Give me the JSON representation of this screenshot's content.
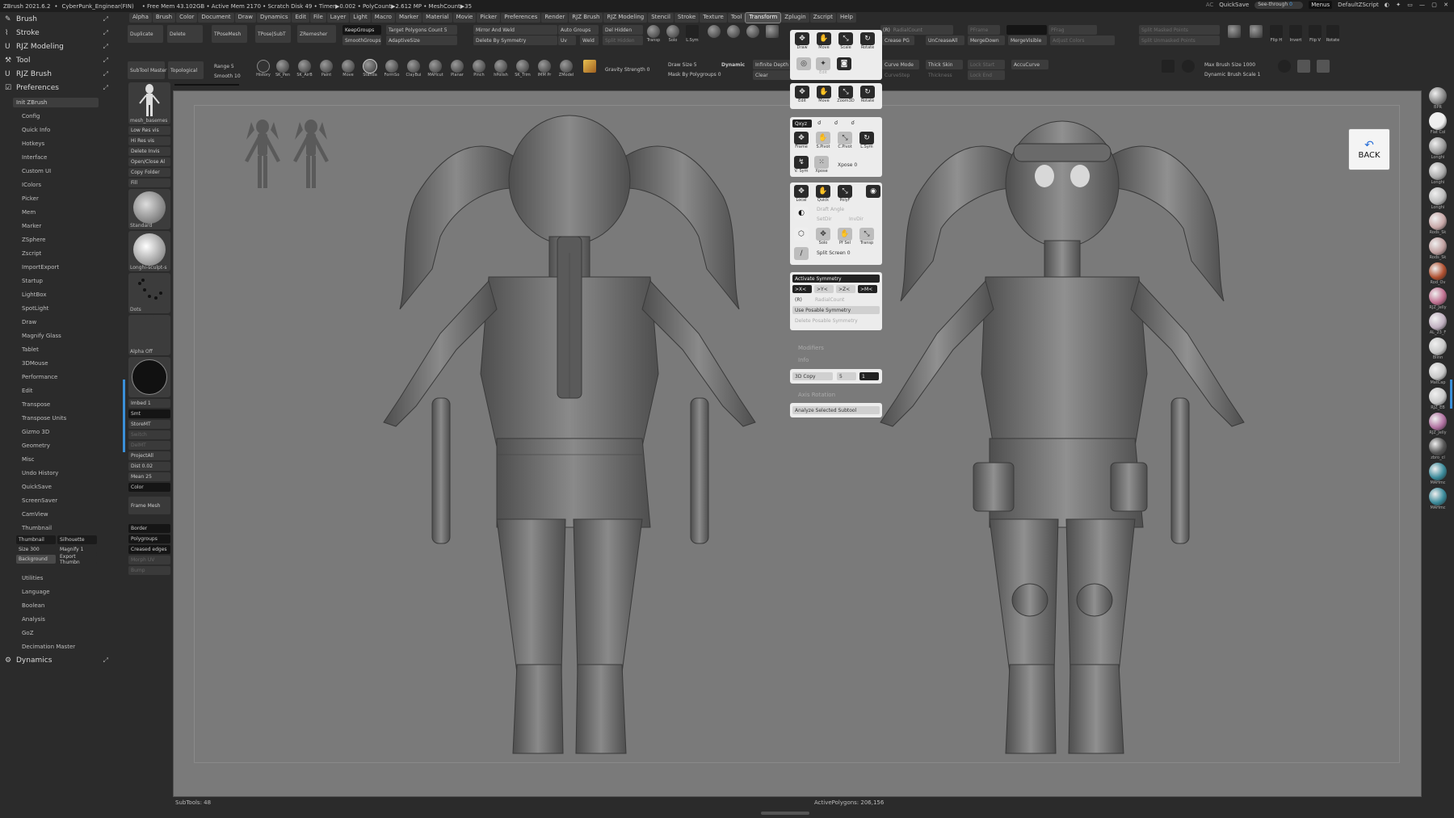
{
  "titlebar": {
    "app": "ZBrush 2021.6.2",
    "file": "CyberPunk_Enginear(FIN)",
    "stats": "• Free Mem 43.102GB • Active Mem 2170 • Scratch Disk 49 • Timer▶0.002 • PolyCount▶2.612 MP • MeshCount▶35",
    "ac": "AC",
    "quicksave": "QuickSave",
    "seethrough": "See-through",
    "seethrough_value": "0",
    "menus": "Menus",
    "zscript": "DefaultZScript"
  },
  "menubar": [
    "Alpha",
    "Brush",
    "Color",
    "Document",
    "Draw",
    "Dynamics",
    "Edit",
    "File",
    "Layer",
    "Light",
    "Macro",
    "Marker",
    "Material",
    "Movie",
    "Picker",
    "Preferences",
    "Render",
    "RJZ Brush",
    "RJZ Modeling",
    "Stencil",
    "Stroke",
    "Texture",
    "Tool",
    "Transform",
    "Zplugin",
    "Zscript",
    "Help"
  ],
  "menubar_active": "Transform",
  "leftpanel": {
    "headers": [
      {
        "icon": "brush-icon",
        "glyph": "✎",
        "label": "Brush"
      },
      {
        "icon": "stroke-icon",
        "glyph": "⌇",
        "label": "Stroke"
      },
      {
        "icon": "user-icon",
        "glyph": "U",
        "label": "RJZ Modeling"
      },
      {
        "icon": "tool-icon",
        "glyph": "⚒",
        "label": "Tool"
      },
      {
        "icon": "user-icon",
        "glyph": "U",
        "label": "RJZ Brush"
      },
      {
        "icon": "checkbox-icon",
        "glyph": "☑",
        "label": "Preferences"
      }
    ],
    "init_button": "Init ZBrush",
    "pref_items": [
      "Config",
      "Quick Info",
      "Hotkeys",
      "Interface",
      "Custom UI",
      "IColors",
      "Picker",
      "Mem",
      "Marker",
      "ZSphere",
      "Zscript",
      "ImportExport",
      "Startup",
      "LightBox",
      "SpotLight",
      "Draw",
      "Magnify Glass",
      "Tablet",
      "3DMouse",
      "Performance",
      "Edit",
      "Transpose",
      "Transpose Units",
      "Gizmo 3D",
      "Geometry",
      "Misc",
      "Undo History",
      "QuickSave",
      "ScreenSaver",
      "CamView",
      "Thumbnail"
    ],
    "thumb_row1": [
      "Thumbnail",
      "Silhouette"
    ],
    "thumb_row2": [
      "Size 300",
      "Magnify 1"
    ],
    "thumb_row3": [
      "Background",
      "Export Thumbn"
    ],
    "post_items": [
      "Utilities",
      "Language",
      "Boolean",
      "Analysis",
      "GoZ",
      "Decimation Master"
    ],
    "dynamics": {
      "glyph": "⚙",
      "label": "Dynamics"
    }
  },
  "toolcol": {
    "subtool_master": "SubTool Master",
    "topological": "Topological",
    "mesh_name": "mesh_basemes",
    "buttons_a": [
      "Low Res vis",
      "Hi Res vis",
      "Delete Invis",
      "Open/Close Al",
      "Copy Folder",
      "Fill"
    ],
    "thumbs": [
      "Standard",
      "Longhi-sculpt-s",
      "Dots",
      "Alpha Off"
    ],
    "buttons_b": [
      "Imbed 1",
      "Smt",
      "StoreMT",
      "Switch",
      "DelMT",
      "ProjectAll",
      "Dist 0.02",
      "Mean 25",
      "Color"
    ],
    "frame_mesh": "Frame Mesh",
    "buttons_c": [
      "Border",
      "Polygroups",
      "Creased edges",
      "Morph UV",
      "Bump"
    ]
  },
  "topbar1": {
    "duplicate": "Duplicate",
    "delete": "Delete",
    "tposemesh": "TPoseMesh",
    "tposesubt": "TPose|SubT",
    "zremesher": "ZRemesher",
    "keepgroups": "KeepGroups",
    "smoothgroups": "SmoothGroups",
    "target_poly": "Target Polygons Count 5",
    "adaptivesize": "AdaptiveSize",
    "mirror_weld": "Mirror And Weld",
    "delete_sym": "Delete By Symmetry",
    "auto_groups": "Auto Groups",
    "uv": "Uv",
    "weld": "Weld",
    "del_hidden": "Del Hidden",
    "split_hidden": "Split Hidden",
    "transp": "Transp",
    "solo": "Solo",
    "lsym": "L.Sym",
    "r": "(R)",
    "radialcount": "RadialCount",
    "pframe": "PFrame",
    "pfrag": "PFrag",
    "crease_pg": "Crease PG",
    "uncreaseall": "UnCreaseAll",
    "mergedown": "MergeDown",
    "mergevisible": "MergeVisible",
    "adjust_colors": "Adjust Colors",
    "split_masked": "Split Masked Points",
    "split_unmasked": "Split Unmasked Points",
    "fliph": "Flip H",
    "invert": "Invert",
    "flipv": "Flip V",
    "rotate": "Rotate"
  },
  "topbar2": {
    "range": "Range 5",
    "smooth": "Smooth 10",
    "history": "History",
    "brushes": [
      "SK_Pen",
      "SK_AirB",
      "Paint",
      "Move",
      "Standa",
      "FormSo",
      "ClayBui",
      "MAHcut",
      "Planar",
      "Pinch",
      "hPolish",
      "SK_Trim",
      "IMM Pr",
      "ZModel"
    ],
    "gravity": "Gravity Strength 0",
    "draw_size": "Draw Size 5",
    "dynamic": "Dynamic",
    "mask_poly": "Mask By Polygroups 0",
    "infinite_depth": "Infinite Depth",
    "clear": "Clear",
    "curve_mode": "Curve Mode",
    "curvestep": "CurveStep",
    "thick_skin": "Thick Skin",
    "thickness": "Thickness",
    "lock_start": "Lock Start",
    "lock_end": "Lock End",
    "accucurve": "AccuCurve",
    "max_brush": "Max Brush Size 1000",
    "dyn_brush_scale": "Dynamic Brush Scale 1"
  },
  "floatpanel": {
    "row1": [
      "Draw",
      "Move",
      "Scale",
      "Rotate"
    ],
    "row2_edit": "Edit",
    "row3": [
      "Edit",
      "Move",
      "Zoom3D",
      "Rotate"
    ],
    "xyz": "Qxyz",
    "row4": [
      "Frame",
      "S.Pivot",
      "C.Pivot",
      "L.Sym"
    ],
    "row5": [
      "V. Sym",
      "Xpose"
    ],
    "xpose_val": "Xpose 0",
    "row6": [
      "Local",
      "Quick",
      "PolyF"
    ],
    "draft": "Draft Angle",
    "setdir": "SetDir",
    "invdir": "InvDir",
    "row7": [
      "Solo",
      "Pf Sel",
      "Transp"
    ],
    "split_screen": "Split Screen 0",
    "activate_sym": "Activate Symmetry",
    "axes": [
      ">X<",
      ">Y<",
      ">Z<",
      ">M<"
    ],
    "r": "(R)",
    "radialcount": "RadialCount",
    "use_posable": "Use Posable Symmetry",
    "delete_posable": "Delete Posable Symmetry",
    "modifiers": "Modifiers",
    "info": "Info",
    "copy3d": "3D Copy",
    "copy3d_a": "5",
    "copy3d_b": "1",
    "axis_rotation": "Axis Rotation",
    "analyze": "Analyze Selected Subtool"
  },
  "rightstrip": [
    "BPR",
    "Flat Col",
    "Longhi",
    "Longhi",
    "Longhi",
    "Rods_Sk",
    "Rods_Sk",
    "Rod_Ov",
    "RJZ_Jelly",
    "AL_23_F",
    "Blinn",
    "MatCap",
    "RJZ_EB",
    "RJZ_Jelly",
    "zbro_cl",
    "MAHmc",
    "MAHmc"
  ],
  "back_button": "BACK",
  "statusbar": {
    "subtools": "SubTools: 48",
    "active_polys": "ActivePolygons: 206,156"
  }
}
